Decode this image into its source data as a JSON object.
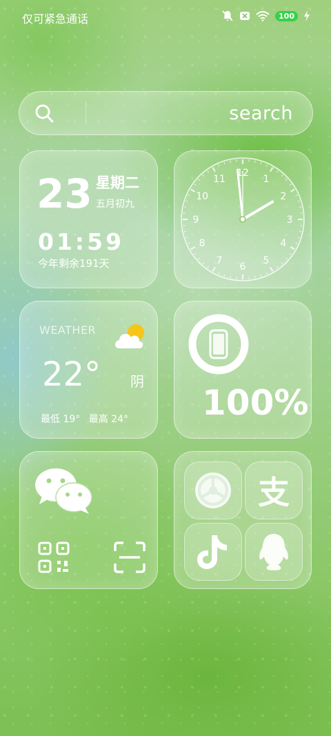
{
  "status_bar": {
    "carrier": "仅可紧急通话",
    "battery": "100"
  },
  "search": {
    "placeholder": "search"
  },
  "date_widget": {
    "day": "23",
    "weekday": "星期二",
    "lunar": "五月初九",
    "time": "01:59",
    "remaining": "今年剩余191天"
  },
  "clock_widget": {
    "numbers": [
      "12",
      "1",
      "2",
      "3",
      "4",
      "5",
      "6",
      "7",
      "8",
      "9",
      "10",
      "11"
    ],
    "hour": 1,
    "minute": 59
  },
  "weather_widget": {
    "label": "WEATHER",
    "temperature": "22°",
    "condition": "阴",
    "low": "最低 19°",
    "high": "最高 24°",
    "icon": "partly-cloudy-icon"
  },
  "battery_widget": {
    "percent": "100%"
  },
  "chat_widget": {
    "icons": [
      "wechat-icon",
      "qr-code-icon",
      "scan-icon"
    ]
  },
  "apps_widget": {
    "apps": [
      {
        "name": "settings",
        "icon": "gear-icon"
      },
      {
        "name": "alipay",
        "glyph": "支"
      },
      {
        "name": "tiktok",
        "icon": "music-note-icon"
      },
      {
        "name": "qq",
        "icon": "penguin-icon"
      }
    ]
  },
  "colors": {
    "battery_pill": "#38d14a",
    "sun": "#f5c518"
  }
}
